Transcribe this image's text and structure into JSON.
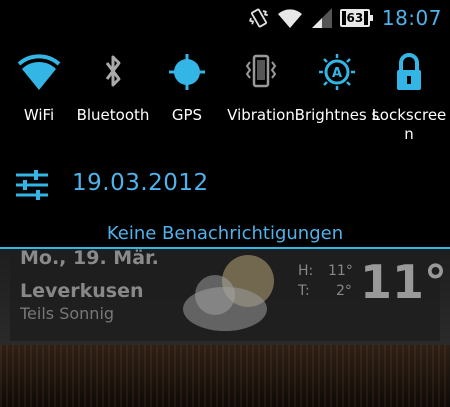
{
  "status_bar": {
    "battery_level": "63",
    "time": "18:07",
    "icons": [
      "vibrate-icon",
      "wifi-icon",
      "signal-icon",
      "battery-icon"
    ]
  },
  "quick_settings": [
    {
      "id": "wifi",
      "label": "WiFi",
      "icon": "wifi-icon"
    },
    {
      "id": "bluetooth",
      "label": "Bluetooth",
      "icon": "bluetooth-icon"
    },
    {
      "id": "gps",
      "label": "GPS",
      "icon": "gps-icon"
    },
    {
      "id": "vibration",
      "label": "Vibration",
      "icon": "vibration-icon"
    },
    {
      "id": "brightness",
      "label": "Brightnes s",
      "icon": "brightness-icon"
    },
    {
      "id": "lockscreen",
      "label": "Lockscree n",
      "icon": "lock-icon"
    }
  ],
  "date_row": {
    "date": "19.03.2012",
    "settings_icon": "settings-sliders-icon"
  },
  "notifications": {
    "empty_text": "Keine Benachrichtigungen"
  },
  "weather_widget": {
    "date": "Mo., 19. Mär.",
    "city": "Leverkusen",
    "condition": "Teils Sonnig",
    "high_label": "H:",
    "high": "11°",
    "low_label": "T:",
    "low": "2°",
    "current": "11°"
  },
  "colors": {
    "accent": "#33b5e5",
    "text_blue": "#4fb2ea",
    "background": "#000000"
  }
}
